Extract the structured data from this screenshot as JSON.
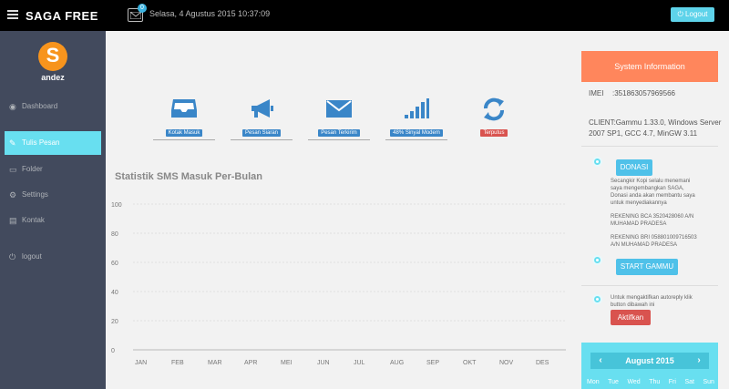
{
  "header": {
    "brand": "SAGA FREE",
    "mail_badge": "0",
    "datetime": "Selasa, 4 Agustus 2015 10:37:09",
    "logout_label": "Logout"
  },
  "sidebar": {
    "avatar_letter": "S",
    "username": "andez",
    "items": [
      {
        "label": "Dashboard",
        "icon": "dashboard-icon"
      },
      {
        "label": "Tulis Pesan",
        "icon": "compose-icon"
      },
      {
        "label": "Folder",
        "icon": "folder-icon"
      },
      {
        "label": "Settings",
        "icon": "cogs-icon"
      },
      {
        "label": "Kontak",
        "icon": "contact-book-icon"
      },
      {
        "label": "logout",
        "icon": "power-icon"
      }
    ]
  },
  "quick_links": [
    {
      "label": "Kotak Masuk",
      "icon": "inbox-icon"
    },
    {
      "label": "Pesan Siaran",
      "icon": "megaphone-icon"
    },
    {
      "label": "Pesan Terkirim",
      "icon": "envelope-icon"
    },
    {
      "label": "48% Sinyal Modem",
      "icon": "signal-icon"
    },
    {
      "label": "Terputus",
      "icon": "refresh-icon"
    }
  ],
  "chart_title": "Statistik SMS Masuk Per-Bulan",
  "chart_data": {
    "type": "line",
    "title": "Statistik SMS Masuk Per-Bulan",
    "categories": [
      "JAN",
      "FEB",
      "MAR",
      "APR",
      "MEI",
      "JUN",
      "JUL",
      "AUG",
      "SEP",
      "OKT",
      "NOV",
      "DES"
    ],
    "yticks": [
      "100",
      "80",
      "60",
      "40",
      "20",
      "0"
    ],
    "ylim": [
      0,
      100
    ],
    "values": [],
    "grid": true
  },
  "right": {
    "sysinfo_title": "System Information",
    "imei_label": "IMEI",
    "imei_value": ":351863057969566",
    "client_text": "CLIENT:Gammu 1.33.0, Windows Server 2007 SP1, GCC 4.7, MinGW 3.11",
    "donasi_label": "DONASI",
    "donasi_text": "Secangkir Kopi selalu menemani saya mengembangkan SAGA, Donasi anda akan membantu saya untuk menyediakannya",
    "rekening_bca": "REKENING BCA 3520428060 A/N MUHAMAD PRADESA",
    "rekening_bri": "REKENING BRI 058801009716503 A/N MUHAMAD PRADESA",
    "start_gammu_label": "START GAMMU",
    "autoreply_text": "Untuk mengaktifkan autoreply klik button dibawah ini",
    "aktifkan_label": "Aktifkan",
    "calendar": {
      "month": "August 2015",
      "prev": "‹",
      "next": "›",
      "days": [
        "Mon",
        "Tue",
        "Wed",
        "Thu",
        "Fri",
        "Sat",
        "Sun"
      ]
    }
  }
}
